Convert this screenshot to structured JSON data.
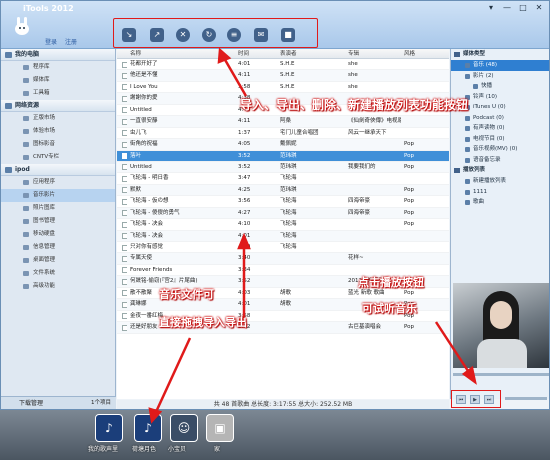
{
  "app": {
    "title": "iTools 2012",
    "login": "登录",
    "register": "注册",
    "win_buttons": [
      "▾",
      "—",
      "□",
      "✕"
    ]
  },
  "toolbar": {
    "icons": [
      "import-icon",
      "export-icon",
      "delete-icon",
      "refresh-icon",
      "playlist-icon",
      "mail-icon",
      "stop-icon"
    ]
  },
  "sidebar": {
    "sections": [
      {
        "title": "我的电脑",
        "items": [
          "程序库",
          "媒体库",
          "工具箱"
        ]
      },
      {
        "title": "网络资源",
        "items": [
          "正版市场",
          "体验市场",
          "图标影音",
          "CNTV专栏"
        ]
      },
      {
        "title": "ipod",
        "items": [
          "应用程序",
          "音乐影片",
          "照片图库",
          "图书管理",
          "移动硬盘",
          "信息管理",
          "桌面管理",
          "文件系统",
          "高级功能"
        ]
      }
    ],
    "selected": "音乐影片",
    "download": "下载管理",
    "download_count": "1个项目"
  },
  "list": {
    "columns": [
      "名称",
      "时间",
      "表演者",
      "专辑",
      "风格"
    ],
    "rows": [
      [
        "花都开好了",
        "4:01",
        "S.H.E",
        "she",
        ""
      ],
      [
        "他还是不懂",
        "4:11",
        "S.H.E",
        "she",
        ""
      ],
      [
        "I Love You",
        "3:58",
        "S.H.E",
        "she",
        ""
      ],
      [
        "謝謝你的愛",
        "4:38",
        "",
        "",
        ""
      ],
      [
        "Untitled",
        "4:45",
        "",
        "",
        ""
      ],
      [
        "一直很安靜",
        "4:11",
        "阿桑",
        "《仙劍奇俠傳》电视原声带",
        ""
      ],
      [
        "虫儿飞",
        "1:37",
        "宅门儿童合唱团",
        "风云一继承天下",
        ""
      ],
      [
        "街角的祝福",
        "4:05",
        "戴佩妮",
        "",
        "Pop"
      ],
      [
        "落叶",
        "3:52",
        "范玮琪",
        "",
        "Pop"
      ],
      [
        "Untitled",
        "3:52",
        "范玮琪",
        "我要我们的",
        "Pop"
      ],
      [
        "飞轮海 - 明日香",
        "3:47",
        "飞轮海",
        "",
        ""
      ],
      [
        "默默",
        "4:25",
        "范玮琪",
        "",
        "Pop"
      ],
      [
        "飞轮海 - 仮の想",
        "3:56",
        "飞轮海",
        "四海帝豪",
        "Pop"
      ],
      [
        "飞轮海 - 傻傻的勇气",
        "4:27",
        "飞轮海",
        "四海帝豪",
        "Pop"
      ],
      [
        "飞轮海 - 决会",
        "4:10",
        "飞轮海",
        "",
        "Pop"
      ],
      [
        "飞轮海 - 决会",
        "4:01",
        "飞轮海",
        "",
        ""
      ],
      [
        "只对你有感觉",
        "4:20",
        "飞轮海",
        "",
        ""
      ],
      [
        "专属天使",
        "3:40",
        "",
        "花样~",
        ""
      ],
      [
        "Forever Friends",
        "3:34",
        "",
        "",
        ""
      ],
      [
        "何晟铭-偷窃(『宫2』片尾曲)",
        "3:52",
        "",
        "2012年的夏天",
        "Pop"
      ],
      [
        "散不散聚",
        "4:03",
        "胡歌",
        "蓝光 新歌 歌曲",
        "Pop"
      ],
      [
        "龚琳娜",
        "4:01",
        "胡歌",
        "",
        "Pop"
      ],
      [
        "金夜一番红梅",
        "3:58",
        "",
        "",
        "Pop"
      ],
      [
        "还是好朋友",
        "3:52",
        "",
        "古巨基演唱会",
        "Pop"
      ]
    ],
    "selected_row": 8,
    "status": "共 48 首歌曲   总长度: 3:17:55   总大小: 252.52 MB"
  },
  "right": {
    "media_title": "媒体类型",
    "media": [
      "音乐 (48)",
      "影片 (2)",
      "铃声 (10)",
      "iTunes U (0)",
      "Podcast (0)",
      "有声读物 (0)",
      "电视节目 (0)",
      "音乐视频(MV) (0)",
      "语音备忘录"
    ],
    "media_sub": "快播",
    "playlist_title": "播放列表",
    "playlists": [
      "新建播放列表",
      "1111",
      "歌曲"
    ]
  },
  "annotations": {
    "top": "导入、导出、删除、新建播放列表功能按钮",
    "mid1": "音乐文件可",
    "mid2": "直接拖拽导入导出",
    "right1": "点击播放按钮",
    "right2": "可试听音乐"
  },
  "desktop": {
    "icons": [
      "我的歌声里",
      "荷塘月色",
      "小宝贝",
      "家"
    ]
  }
}
